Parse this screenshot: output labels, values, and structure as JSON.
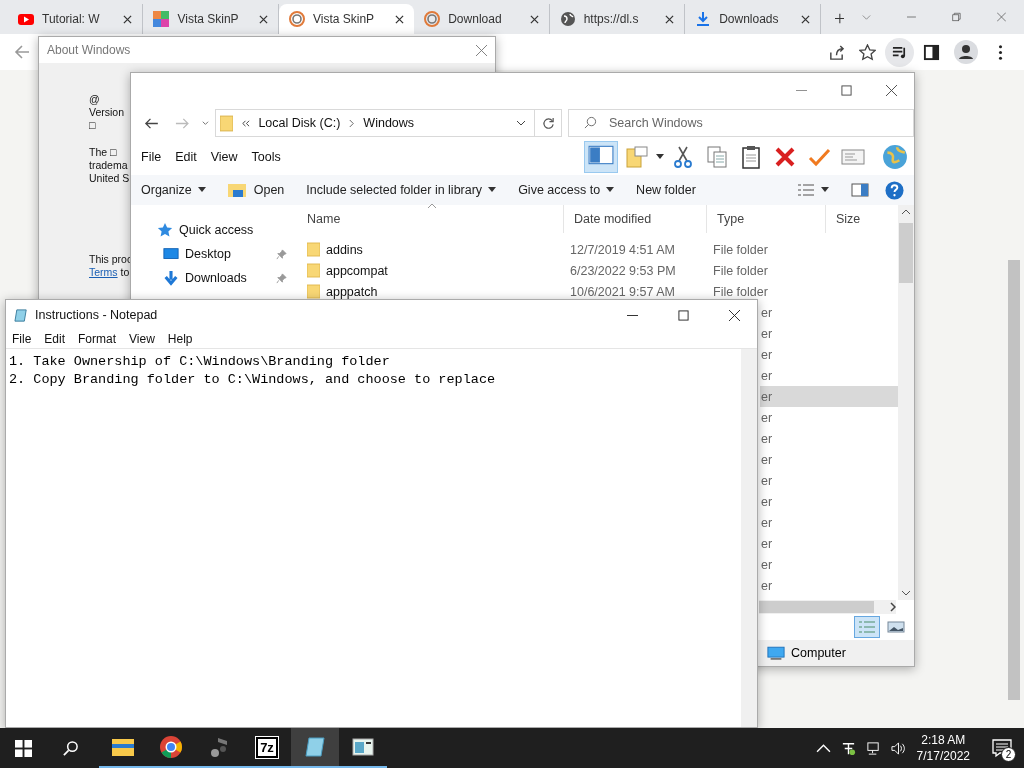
{
  "browser": {
    "tabs": [
      {
        "title": "Tutorial: W",
        "kind": "video",
        "selected": false
      },
      {
        "title": "Vista SkinP",
        "kind": "tiles",
        "selected": false
      },
      {
        "title": "Vista SkinP",
        "kind": "swirl",
        "selected": true
      },
      {
        "title": "Download",
        "kind": "swirl",
        "selected": false
      },
      {
        "title": "https://dl.s",
        "kind": "globe",
        "selected": false
      },
      {
        "title": "Downloads",
        "kind": "download",
        "selected": false
      }
    ]
  },
  "about_dialog": {
    "title": "About Windows",
    "lines": [
      "@",
      "Version",
      "□"
    ],
    "paragraph": [
      "The □",
      "tradema",
      "United S"
    ],
    "notice": "This proc",
    "link": "Terms",
    "link_tail": "to"
  },
  "explorer": {
    "breadcrumb": [
      "Local Disk (C:)",
      "Windows"
    ],
    "search": {
      "placeholder": "Search Windows"
    },
    "menu": [
      "File",
      "Edit",
      "View",
      "Tools"
    ],
    "commands": [
      {
        "label": "Organize",
        "kind": "dropdown"
      },
      {
        "label": "Open",
        "kind": "icon"
      },
      {
        "label": "Include selected folder in library",
        "kind": "dropdown"
      },
      {
        "label": "Give access to",
        "kind": "dropdown"
      },
      {
        "label": "New folder",
        "kind": "plain"
      }
    ],
    "nav": [
      {
        "label": "Quick access",
        "kind": "star",
        "pinned": false
      },
      {
        "label": "Desktop",
        "kind": "desktop",
        "pinned": true
      },
      {
        "label": "Downloads",
        "kind": "download",
        "pinned": true
      }
    ],
    "columns": [
      "Name",
      "Date modified",
      "Type",
      "Size"
    ],
    "rows": [
      {
        "name": "addins",
        "date": "12/7/2019 4:51 AM",
        "type": "File folder"
      },
      {
        "name": "appcompat",
        "date": "6/23/2022 9:53 PM",
        "type": "File folder"
      },
      {
        "name": "apppatch",
        "date": "10/6/2021 9:57 AM",
        "type": "File folder"
      }
    ],
    "hidden_rows": [
      {
        "type_tail": "er",
        "selected": false
      },
      {
        "type_tail": "er",
        "selected": false
      },
      {
        "type_tail": "er",
        "selected": false
      },
      {
        "type_tail": "er",
        "selected": false
      },
      {
        "type_tail": "er",
        "selected": true
      },
      {
        "type_tail": "er",
        "selected": false
      },
      {
        "type_tail": "er",
        "selected": false
      },
      {
        "type_tail": "er",
        "selected": false
      },
      {
        "type_tail": "er",
        "selected": false
      },
      {
        "type_tail": "er",
        "selected": false
      },
      {
        "type_tail": "er",
        "selected": false
      },
      {
        "type_tail": "er",
        "selected": false
      },
      {
        "type_tail": "er",
        "selected": false
      },
      {
        "type_tail": "er",
        "selected": false
      }
    ],
    "status": "Computer"
  },
  "notepad": {
    "title": "Instructions - Notepad",
    "menu": [
      "File",
      "Edit",
      "Format",
      "View",
      "Help"
    ],
    "lines": [
      "1. Take Ownership of C:\\Windows\\Branding folder",
      "2. Copy Branding folder to C:\\Windows, and choose to replace"
    ]
  },
  "taskbar": {
    "apps": [
      {
        "kind": "folder",
        "selected": false
      },
      {
        "kind": "browser",
        "selected": false
      },
      {
        "kind": "media",
        "selected": false
      },
      {
        "kind": "archive",
        "label": "7z",
        "selected": false
      },
      {
        "kind": "notepad",
        "selected": true
      },
      {
        "kind": "window",
        "selected": false
      }
    ],
    "time": "2:18 AM",
    "date": "7/17/2022",
    "notifications": "2"
  }
}
